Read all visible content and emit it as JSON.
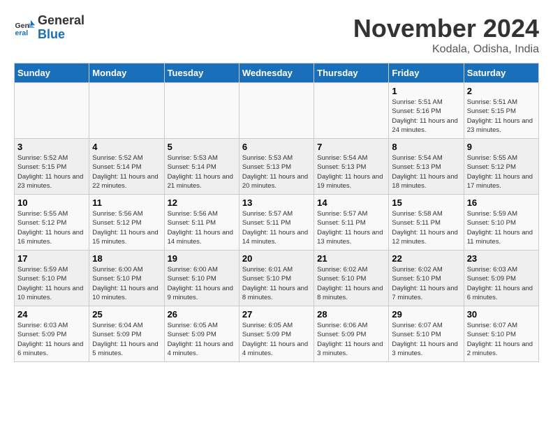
{
  "logo": {
    "line1": "General",
    "line2": "Blue"
  },
  "title": "November 2024",
  "location": "Kodala, Odisha, India",
  "weekdays": [
    "Sunday",
    "Monday",
    "Tuesday",
    "Wednesday",
    "Thursday",
    "Friday",
    "Saturday"
  ],
  "weeks": [
    [
      {
        "day": "",
        "info": ""
      },
      {
        "day": "",
        "info": ""
      },
      {
        "day": "",
        "info": ""
      },
      {
        "day": "",
        "info": ""
      },
      {
        "day": "",
        "info": ""
      },
      {
        "day": "1",
        "info": "Sunrise: 5:51 AM\nSunset: 5:16 PM\nDaylight: 11 hours and 24 minutes."
      },
      {
        "day": "2",
        "info": "Sunrise: 5:51 AM\nSunset: 5:15 PM\nDaylight: 11 hours and 23 minutes."
      }
    ],
    [
      {
        "day": "3",
        "info": "Sunrise: 5:52 AM\nSunset: 5:15 PM\nDaylight: 11 hours and 23 minutes."
      },
      {
        "day": "4",
        "info": "Sunrise: 5:52 AM\nSunset: 5:14 PM\nDaylight: 11 hours and 22 minutes."
      },
      {
        "day": "5",
        "info": "Sunrise: 5:53 AM\nSunset: 5:14 PM\nDaylight: 11 hours and 21 minutes."
      },
      {
        "day": "6",
        "info": "Sunrise: 5:53 AM\nSunset: 5:13 PM\nDaylight: 11 hours and 20 minutes."
      },
      {
        "day": "7",
        "info": "Sunrise: 5:54 AM\nSunset: 5:13 PM\nDaylight: 11 hours and 19 minutes."
      },
      {
        "day": "8",
        "info": "Sunrise: 5:54 AM\nSunset: 5:13 PM\nDaylight: 11 hours and 18 minutes."
      },
      {
        "day": "9",
        "info": "Sunrise: 5:55 AM\nSunset: 5:12 PM\nDaylight: 11 hours and 17 minutes."
      }
    ],
    [
      {
        "day": "10",
        "info": "Sunrise: 5:55 AM\nSunset: 5:12 PM\nDaylight: 11 hours and 16 minutes."
      },
      {
        "day": "11",
        "info": "Sunrise: 5:56 AM\nSunset: 5:12 PM\nDaylight: 11 hours and 15 minutes."
      },
      {
        "day": "12",
        "info": "Sunrise: 5:56 AM\nSunset: 5:11 PM\nDaylight: 11 hours and 14 minutes."
      },
      {
        "day": "13",
        "info": "Sunrise: 5:57 AM\nSunset: 5:11 PM\nDaylight: 11 hours and 14 minutes."
      },
      {
        "day": "14",
        "info": "Sunrise: 5:57 AM\nSunset: 5:11 PM\nDaylight: 11 hours and 13 minutes."
      },
      {
        "day": "15",
        "info": "Sunrise: 5:58 AM\nSunset: 5:11 PM\nDaylight: 11 hours and 12 minutes."
      },
      {
        "day": "16",
        "info": "Sunrise: 5:59 AM\nSunset: 5:10 PM\nDaylight: 11 hours and 11 minutes."
      }
    ],
    [
      {
        "day": "17",
        "info": "Sunrise: 5:59 AM\nSunset: 5:10 PM\nDaylight: 11 hours and 10 minutes."
      },
      {
        "day": "18",
        "info": "Sunrise: 6:00 AM\nSunset: 5:10 PM\nDaylight: 11 hours and 10 minutes."
      },
      {
        "day": "19",
        "info": "Sunrise: 6:00 AM\nSunset: 5:10 PM\nDaylight: 11 hours and 9 minutes."
      },
      {
        "day": "20",
        "info": "Sunrise: 6:01 AM\nSunset: 5:10 PM\nDaylight: 11 hours and 8 minutes."
      },
      {
        "day": "21",
        "info": "Sunrise: 6:02 AM\nSunset: 5:10 PM\nDaylight: 11 hours and 8 minutes."
      },
      {
        "day": "22",
        "info": "Sunrise: 6:02 AM\nSunset: 5:10 PM\nDaylight: 11 hours and 7 minutes."
      },
      {
        "day": "23",
        "info": "Sunrise: 6:03 AM\nSunset: 5:09 PM\nDaylight: 11 hours and 6 minutes."
      }
    ],
    [
      {
        "day": "24",
        "info": "Sunrise: 6:03 AM\nSunset: 5:09 PM\nDaylight: 11 hours and 6 minutes."
      },
      {
        "day": "25",
        "info": "Sunrise: 6:04 AM\nSunset: 5:09 PM\nDaylight: 11 hours and 5 minutes."
      },
      {
        "day": "26",
        "info": "Sunrise: 6:05 AM\nSunset: 5:09 PM\nDaylight: 11 hours and 4 minutes."
      },
      {
        "day": "27",
        "info": "Sunrise: 6:05 AM\nSunset: 5:09 PM\nDaylight: 11 hours and 4 minutes."
      },
      {
        "day": "28",
        "info": "Sunrise: 6:06 AM\nSunset: 5:09 PM\nDaylight: 11 hours and 3 minutes."
      },
      {
        "day": "29",
        "info": "Sunrise: 6:07 AM\nSunset: 5:10 PM\nDaylight: 11 hours and 3 minutes."
      },
      {
        "day": "30",
        "info": "Sunrise: 6:07 AM\nSunset: 5:10 PM\nDaylight: 11 hours and 2 minutes."
      }
    ]
  ]
}
